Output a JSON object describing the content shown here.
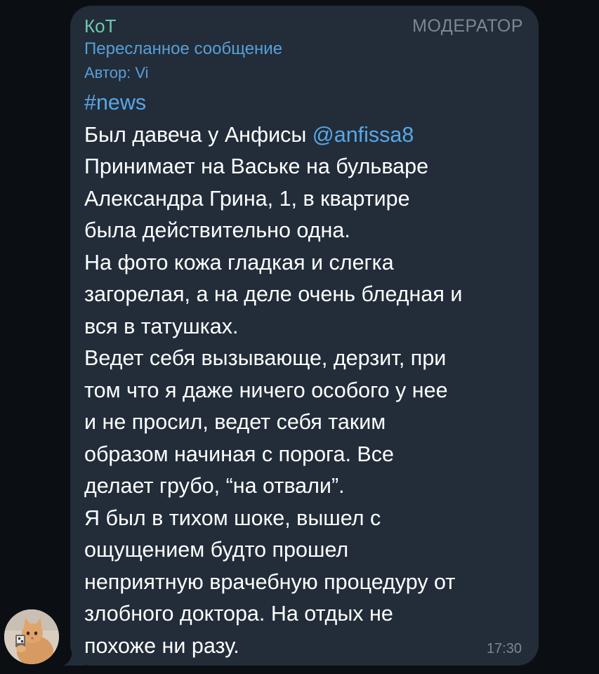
{
  "message": {
    "sender_name": "КоТ",
    "sender_role": "МОДЕРАТОР",
    "forwarded_label": "Пересланное сообщение",
    "forwarded_author": "Автор: Vi",
    "hashtag": "#news",
    "mention": "@anfissa8",
    "time": "17:30",
    "lines": [
      "Был давеча у Анфисы ",
      "Принимает на Ваське на бульваре",
      "Александра Грина, 1, в  квартире",
      "была действительно одна.",
      "На фото кожа гладкая и слегка",
      "загорелая, а на деле очень бледная и",
      "вся в татушках.",
      "Ведет себя вызывающе, дерзит, при",
      "том что я даже ничего особого у нее",
      "и не просил, ведет себя таким",
      "образом начиная с порога. Все",
      "делает грубо, “на отвали”.",
      "Я был в тихом шоке, вышел с",
      "ощущением будто прошел",
      "неприятную врачебную процедуру от",
      "злобного доктора. На отдых не",
      "похоже ни разу."
    ]
  },
  "colors": {
    "background": "#0b0f14",
    "bubble": "#222d39",
    "sender": "#6fc7ad",
    "link": "#5aa6e6",
    "meta": "#7c8792"
  },
  "icons": {
    "avatar": "cat-photo-avatar"
  }
}
